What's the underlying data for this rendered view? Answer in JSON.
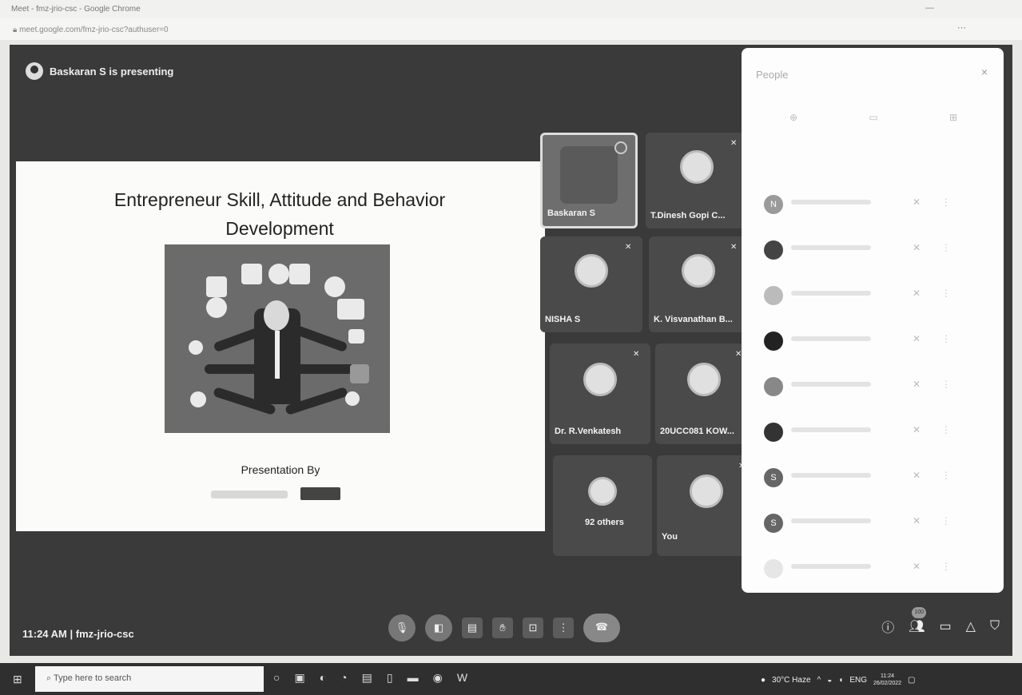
{
  "browser": {
    "title": "Meet - fmz-jrio-csc - Google Chrome",
    "url": "meet.google.com/fmz-jrio-csc?authuser=0"
  },
  "presenter_bar": {
    "text": "Baskaran S is presenting"
  },
  "slide": {
    "title": "Entrepreneur Skill, Attitude and Behavior Development",
    "presentation_by": "Presentation By"
  },
  "tiles": [
    {
      "name": "Baskaran S"
    },
    {
      "name": "T.Dinesh Gopi C..."
    },
    {
      "name": "NISHA S"
    },
    {
      "name": "K. Visvanathan B..."
    },
    {
      "name": "Dr. R.Venkatesh"
    },
    {
      "name": "20UCC081 KOW..."
    },
    {
      "name": "92 others"
    },
    {
      "name": "You"
    }
  ],
  "people_panel": {
    "title": "People",
    "close": "×"
  },
  "people_list": [
    {
      "initial": "N"
    },
    {
      "initial": ""
    },
    {
      "initial": ""
    },
    {
      "initial": ""
    },
    {
      "initial": ""
    },
    {
      "initial": ""
    },
    {
      "initial": "S"
    },
    {
      "initial": "S"
    },
    {
      "initial": ""
    }
  ],
  "meeting": {
    "time": "11:24 AM",
    "code": "fmz-jrio-csc",
    "separator": "|",
    "participant_count": "100"
  },
  "taskbar": {
    "search_placeholder": "Type here to search",
    "weather": "30°C Haze",
    "lang": "ENG",
    "time": "11:24",
    "date": "26/02/2022"
  },
  "colors": {
    "meet_bg": "#3a3a3a",
    "panel_bg": "#fdfdfd",
    "taskbar_bg": "#2f2f2f"
  }
}
